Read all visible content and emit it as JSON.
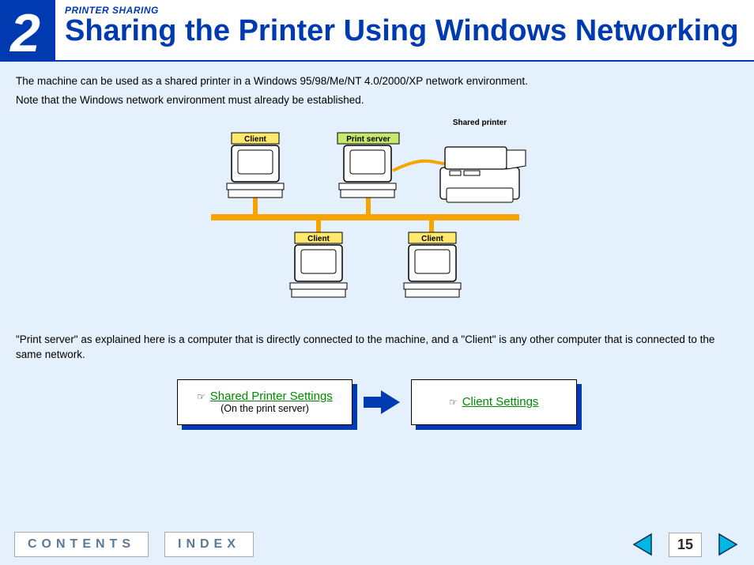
{
  "header": {
    "chapter_number": "2",
    "eyebrow": "PRINTER SHARING",
    "title": "Sharing the Printer Using Windows Networking"
  },
  "intro_line1": "The machine can be used as a shared printer in a Windows 95/98/Me/NT 4.0/2000/XP network environment.",
  "intro_line2": "Note that the Windows network environment must already be established.",
  "diagram": {
    "client_label": "Client",
    "print_server_label": "Print server",
    "shared_printer_label": "Shared printer"
  },
  "caption2": "\"Print server\" as explained here is a computer that is directly connected to the machine, and a \"Client\" is any other computer that is connected to the same network.",
  "links": {
    "box1_title": "Shared Printer Settings",
    "box1_sub": "(On the print server)",
    "box2_title": "Client Settings"
  },
  "footer": {
    "contents": "CONTENTS",
    "index": "INDEX",
    "page_number": "15"
  }
}
